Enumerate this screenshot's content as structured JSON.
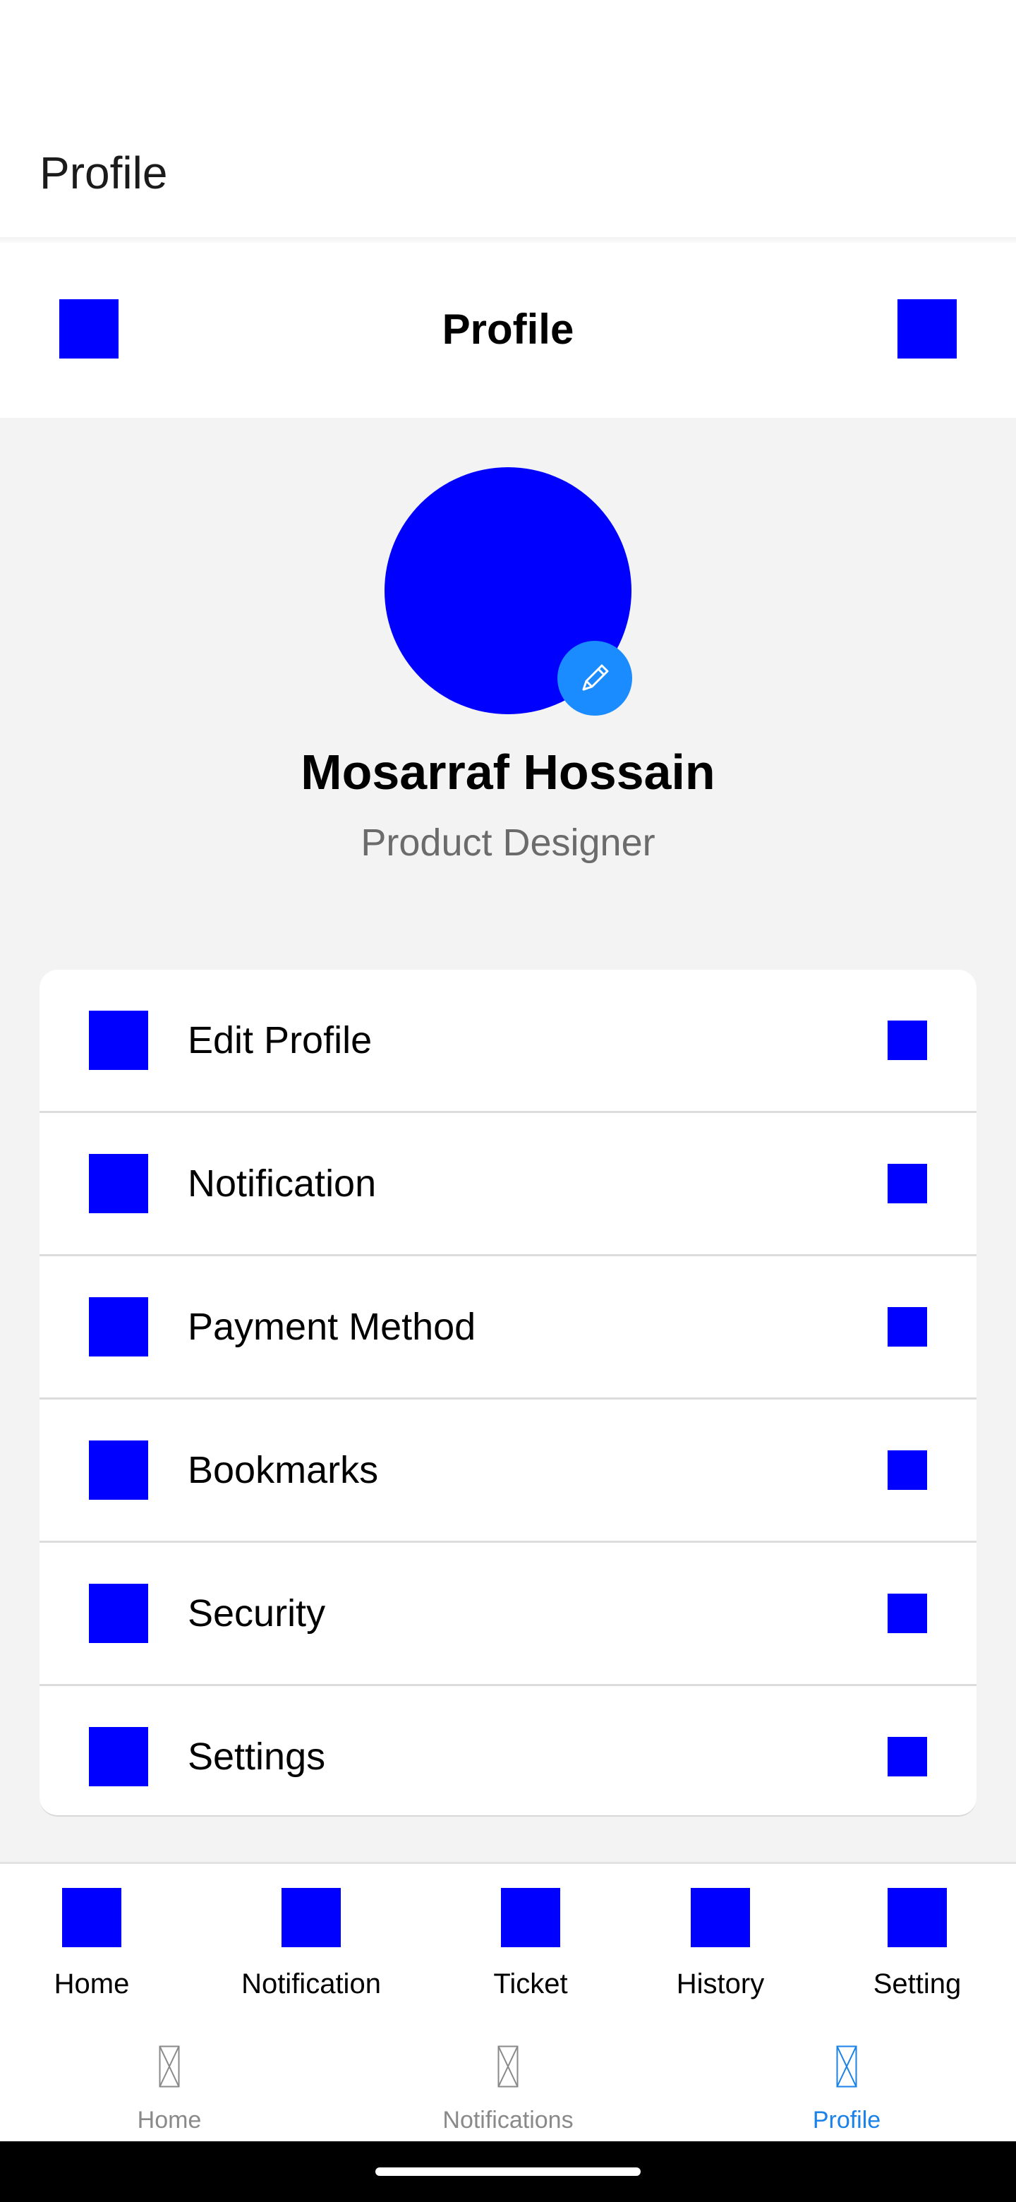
{
  "appbar": {
    "title": "Profile"
  },
  "header": {
    "title": "Profile",
    "left_icon": "back-icon",
    "right_icon": "more-icon"
  },
  "profile": {
    "name": "Mosarraf Hossain",
    "role": "Product Designer",
    "edit_icon": "pencil-icon"
  },
  "menu": {
    "items": [
      {
        "label": "Edit Profile",
        "icon": "user-icon"
      },
      {
        "label": "Notification",
        "icon": "bell-icon"
      },
      {
        "label": "Payment Method",
        "icon": "card-icon"
      },
      {
        "label": "Bookmarks",
        "icon": "bookmark-icon"
      },
      {
        "label": "Security",
        "icon": "shield-icon"
      },
      {
        "label": "Settings",
        "icon": "gear-icon"
      }
    ]
  },
  "tabbar": {
    "items": [
      {
        "label": "Home"
      },
      {
        "label": "Notification"
      },
      {
        "label": "Ticket"
      },
      {
        "label": "History"
      },
      {
        "label": "Setting"
      }
    ]
  },
  "navbar": {
    "items": [
      {
        "label": "Home",
        "active": false
      },
      {
        "label": "Notifications",
        "active": false
      },
      {
        "label": "Profile",
        "active": true
      }
    ]
  },
  "colors": {
    "icon_placeholder": "#0000ff",
    "accent": "#1a82e8",
    "background": "#f3f3f3"
  }
}
